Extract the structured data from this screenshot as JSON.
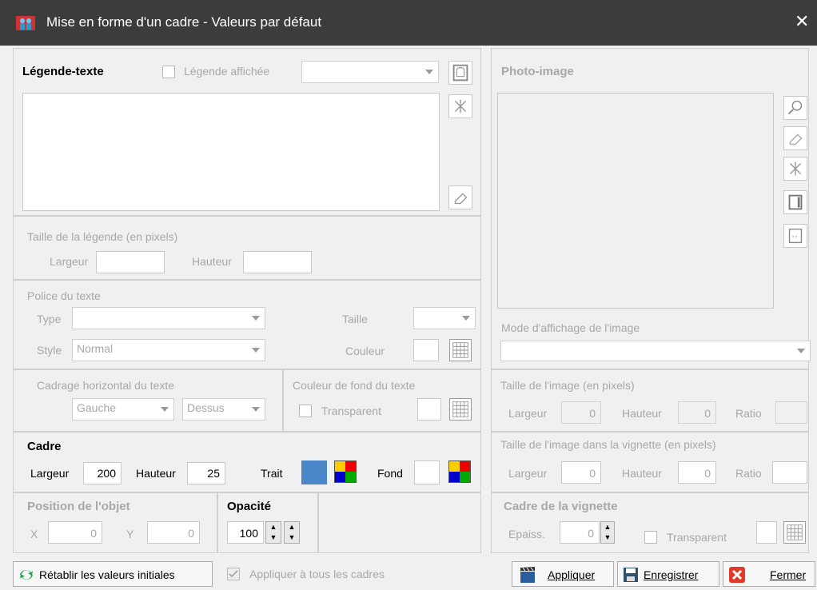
{
  "window": {
    "title": "Mise en forme d'un cadre - Valeurs par défaut",
    "close_glyph": "✕"
  },
  "legend": {
    "heading": "Légende-texte",
    "shown_label": "Légende affichée",
    "size_title": "Taille de la légende (en pixels)",
    "width_label": "Largeur",
    "height_label": "Hauteur"
  },
  "font": {
    "title": "Police du texte",
    "type_label": "Type",
    "style_label": "Style",
    "style_value": "Normal",
    "size_label": "Taille",
    "color_label": "Couleur"
  },
  "framing": {
    "title": "Cadrage horizontal du texte",
    "h_value": "Gauche",
    "v_value": "Dessus"
  },
  "bgcolor": {
    "title": "Couleur de fond du texte",
    "transparent_label": "Transparent"
  },
  "cadre": {
    "heading": "Cadre",
    "width_label": "Largeur",
    "width_value": "200",
    "height_label": "Hauteur",
    "height_value": "25",
    "stroke_label": "Trait",
    "stroke_color": "#4a86c8",
    "fill_label": "Fond"
  },
  "position": {
    "title": "Position de l'objet",
    "x_label": "X",
    "x_value": "0",
    "y_label": "Y",
    "y_value": "0"
  },
  "opacity": {
    "title": "Opacité",
    "value": "100"
  },
  "photo": {
    "heading": "Photo-image",
    "mode_title": "Mode d'affichage de l'image",
    "size_title": "Taille de l'image (en pixels)",
    "width_label": "Largeur",
    "width_value": "0",
    "height_label": "Hauteur",
    "height_value": "0",
    "ratio_label": "Ratio",
    "thumb_title": "Taille de l'image dans la vignette (en pixels)",
    "thumb_width_value": "0",
    "thumb_height_value": "0"
  },
  "vignette": {
    "title": "Cadre de la vignette",
    "thickness_label": "Epaiss.",
    "thickness_value": "0",
    "transparent_label": "Transparent"
  },
  "footer": {
    "reset_label": "Rétablir les valeurs initiales",
    "apply_all_label": "Appliquer à tous les cadres",
    "apply_label": "Appliquer",
    "save_label": "Enregistrer",
    "close_label": "Fermer"
  },
  "icons": [
    "app-icon",
    "close-icon",
    "frame-icon",
    "symbol-icon",
    "eraser-icon",
    "magnifier-icon",
    "border-icon",
    "crop-icon",
    "color-grid-icon",
    "refresh-icon",
    "clapper-icon",
    "floppy-icon",
    "cancel-icon"
  ]
}
